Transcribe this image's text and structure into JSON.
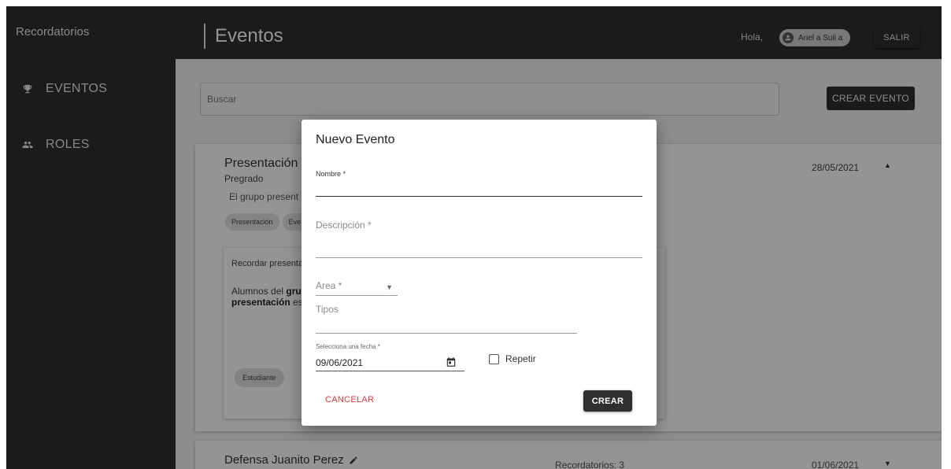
{
  "app": {
    "title": "Recordatorios"
  },
  "sidebar": {
    "items": [
      {
        "label": "EVENTOS",
        "icon": "trophy-icon"
      },
      {
        "label": "ROLES",
        "icon": "people-icon"
      }
    ]
  },
  "header": {
    "title": "Eventos",
    "greeting": "Hola,",
    "user_name": "Ariel a Suil a",
    "logout_label": "SALIR"
  },
  "main": {
    "search_placeholder": "Buscar",
    "create_event_label": "CREAR EVENTO",
    "events": [
      {
        "title": "Presentación C",
        "subtitle": "Pregrado",
        "description": "El grupo present",
        "tags": [
          "Presentación",
          "Eve"
        ],
        "date": "28/05/2021",
        "expanded_icon": "▲",
        "reminder": {
          "title": "Recordar presenta",
          "body_prefix": "Alumnos del ",
          "body_bold1": "gru",
          "body_bold2": "presentación",
          "body_suffix": " es",
          "tag": "Estudiante"
        }
      },
      {
        "title": "Defensa Juanito Perez",
        "reminders": "Recordatorios: 3",
        "date": "01/06/2021",
        "expanded_icon": "▼"
      }
    ]
  },
  "dialog": {
    "title": "Nuevo Evento",
    "nombre_label": "Nombre *",
    "descripcion_label": "Descripción *",
    "area_label": "Area *",
    "area_caret": "▼",
    "tipos_label": "Tipos",
    "fecha_label": "Selecciona una fecha *",
    "fecha_value": "09/06/2021",
    "repeat_label": "Repetir",
    "cancel_label": "CANCELAR",
    "create_label": "CREAR"
  },
  "colors": {
    "dark": "#2f2f2f",
    "cancel": "#e53935",
    "overlay": "rgba(0,0,0,0.42)"
  }
}
